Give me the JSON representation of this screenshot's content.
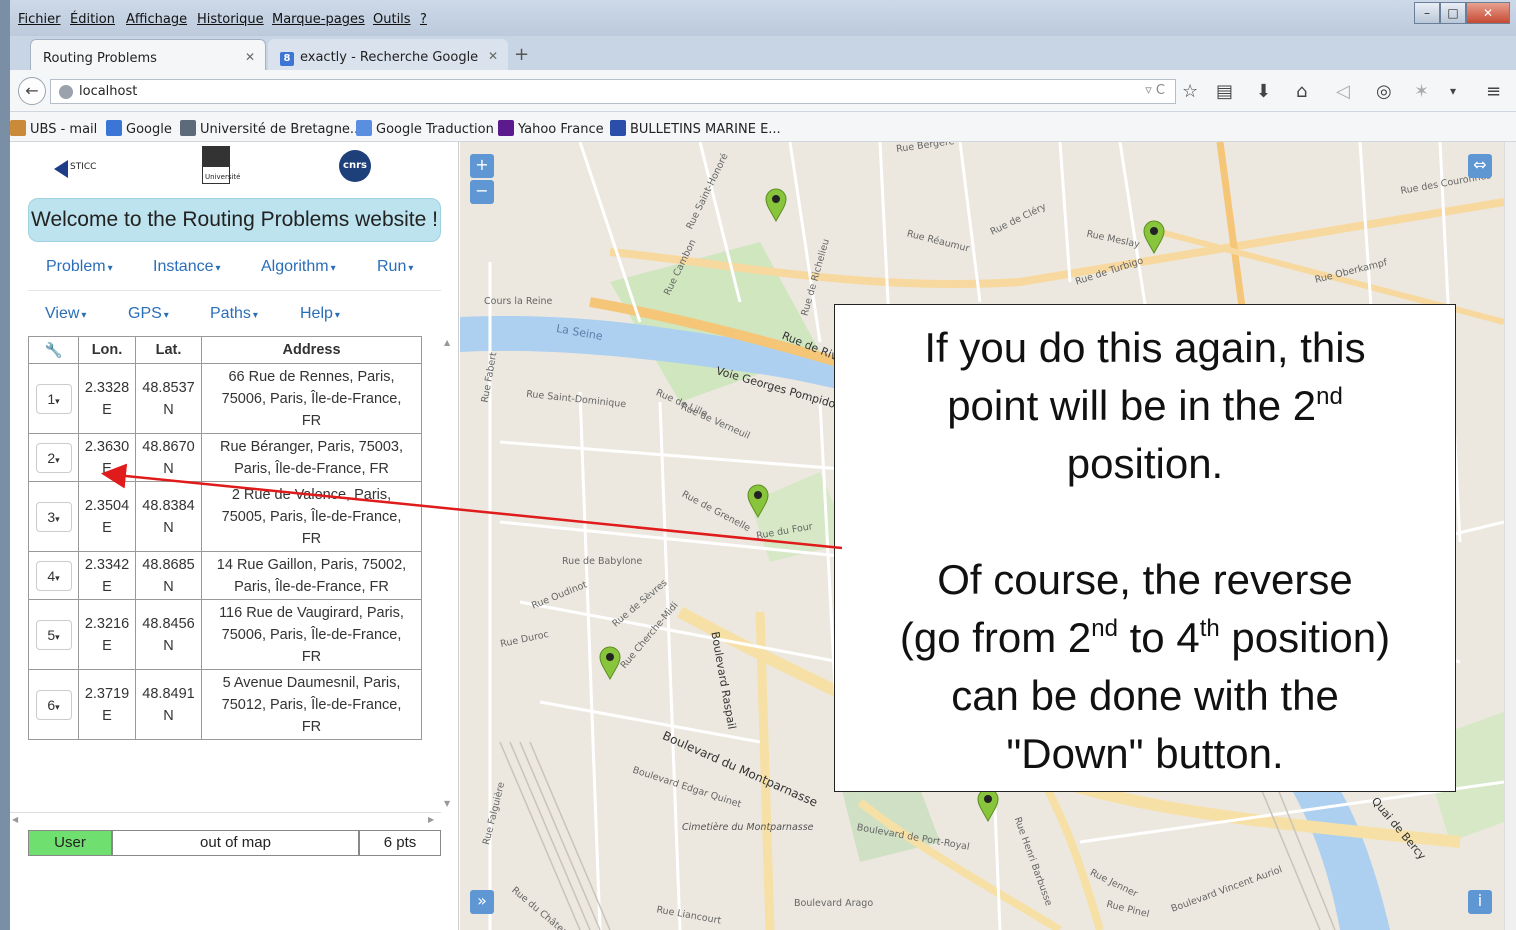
{
  "browser": {
    "menu": [
      "Fichier",
      "Édition",
      "Affichage",
      "Historique",
      "Marque-pages",
      "Outils",
      "?"
    ],
    "tabs": [
      {
        "title": "Routing Problems",
        "active": true
      },
      {
        "title": "exactly - Recherche Google",
        "active": false
      }
    ],
    "url": "localhost",
    "bookmarks": [
      "UBS - mail",
      "Google",
      "Université de Bretagne...",
      "Google Traduction",
      "Yahoo France",
      "BULLETINS MARINE E..."
    ]
  },
  "sidebar": {
    "logos": {
      "lab": "STICC",
      "lab_prefix": "Lab",
      "ubs": "Université",
      "cnrs": "cnrs"
    },
    "welcome": "Welcome to the Routing Problems website !",
    "menus_row1": [
      "Problem",
      "Instance",
      "Algorithm",
      "Run"
    ],
    "menus_row2": [
      "View",
      "GPS",
      "Paths",
      "Help"
    ],
    "table": {
      "headers": [
        "Lon.",
        "Lat.",
        "Address"
      ],
      "rows": [
        {
          "idx": "1",
          "lon": [
            "2.3328",
            "E"
          ],
          "lat": [
            "48.8537",
            "N"
          ],
          "addr": [
            "66 Rue de Rennes, Paris,",
            "75006, Paris, Île-de-France,",
            "FR"
          ]
        },
        {
          "idx": "2",
          "lon": [
            "2.3630",
            "E"
          ],
          "lat": [
            "48.8670",
            "N"
          ],
          "addr": [
            "Rue Béranger, Paris, 75003,",
            "Paris, Île-de-France, FR"
          ]
        },
        {
          "idx": "3",
          "lon": [
            "2.3504",
            "E"
          ],
          "lat": [
            "48.8384",
            "N"
          ],
          "addr": [
            "2 Rue de Valence, Paris,",
            "75005, Paris, Île-de-France,",
            "FR"
          ]
        },
        {
          "idx": "4",
          "lon": [
            "2.3342",
            "E"
          ],
          "lat": [
            "48.8685",
            "N"
          ],
          "addr": [
            "14 Rue Gaillon, Paris, 75002,",
            "Paris, Île-de-France, FR"
          ]
        },
        {
          "idx": "5",
          "lon": [
            "2.3216",
            "E"
          ],
          "lat": [
            "48.8456",
            "N"
          ],
          "addr": [
            "116 Rue de Vaugirard, Paris,",
            "75006, Paris, Île-de-France,",
            "FR"
          ]
        },
        {
          "idx": "6",
          "lon": [
            "2.3719",
            "E"
          ],
          "lat": [
            "48.8491",
            "N"
          ],
          "addr": [
            "5 Avenue Daumesnil, Paris,",
            "75012, Paris, Île-de-France,",
            "FR"
          ]
        }
      ]
    },
    "status": {
      "user": "User",
      "map": "out of map",
      "pts": "6 pts"
    }
  },
  "map": {
    "zoom_in": "+",
    "zoom_out": "−",
    "expand": "⇔",
    "sidebar_toggle": "»",
    "info": "i",
    "street_labels": [
      "Rue Bergère",
      "Rue Réaumur",
      "Rue Meslay",
      "Rue de Turbigo",
      "Rue de Cléry",
      "Cours la Reine",
      "La Seine",
      "Rue de Rivoli",
      "Voie Georges Pompidou",
      "Rue Saint-Dominique",
      "Rue de Lille",
      "Rue de Verneuil",
      "Rue de Grenelle",
      "Rue de Babylone",
      "Rue Oudinot",
      "Rue de Sèvres",
      "Rue Duroc",
      "Boulevard Raspail",
      "Boulevard du Montparnasse",
      "Boulevard Edgar Quinet",
      "Cimetière du Montparnasse",
      "Boulevard de Port-Royal",
      "Boulevard Arago",
      "Quai de Bercy",
      "Rue de Vaugirard",
      "Rue Saint-Honoré",
      "Rue Cambon",
      "Rue de Richelieu",
      "Rue des Couronnes",
      "Rue Oberkampf",
      "Rue Falguière",
      "Rue Fabert",
      "Boulevard Vincent Auriol",
      "Rue du Four",
      "Rue de Seine",
      "Rue Bonaparte",
      "Rue Vavin",
      "Rue d'Assas",
      "Rue Vignon",
      "Rue de Vaugirard",
      "Rue Cherche-Midi",
      "Rue Pinel",
      "Rue Jenner",
      "Rue Liancourt",
      "Rue du Château",
      "Rue Henri Barbusse"
    ]
  },
  "callout": {
    "p1": [
      "If you do this again, this",
      "point will be in the 2",
      "nd",
      "position."
    ],
    "p2": [
      "Of course, the reverse",
      "(go from 2",
      "nd",
      " to 4",
      "th",
      " position)",
      "can be done with the",
      "\"Down\"  button."
    ]
  }
}
